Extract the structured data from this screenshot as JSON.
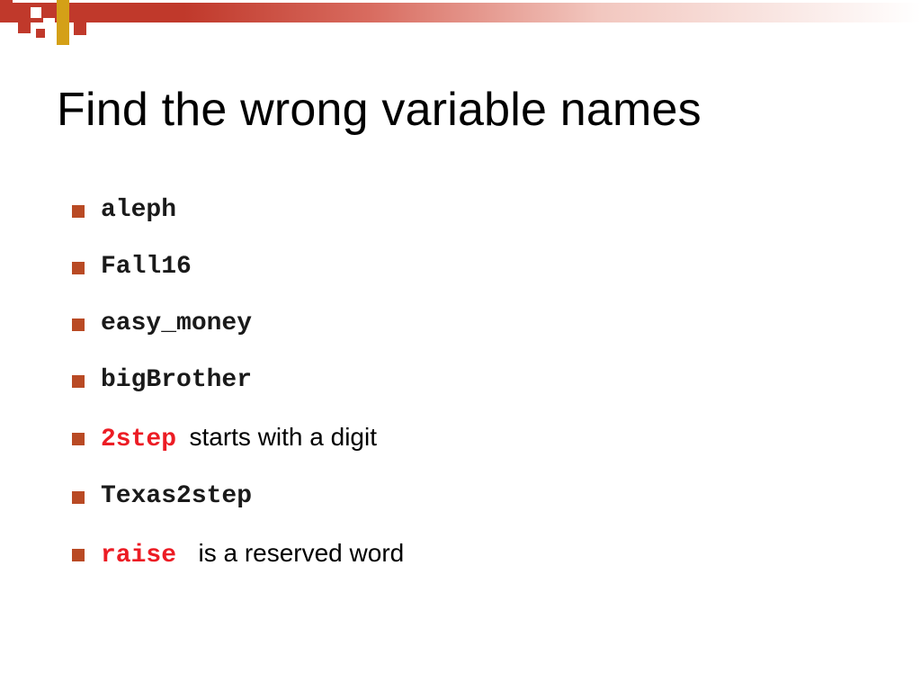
{
  "title": "Find the wrong variable names",
  "items": [
    {
      "code": "aleph",
      "code_color": "black",
      "note": ""
    },
    {
      "code": "Fall16",
      "code_color": "black",
      "note": ""
    },
    {
      "code": "easy_money",
      "code_color": "black",
      "note": ""
    },
    {
      "code": "bigBrother",
      "code_color": "black",
      "note": ""
    },
    {
      "code": "2step",
      "code_color": "red",
      "note": "starts with a digit"
    },
    {
      "code": "Texas2step",
      "code_color": "black",
      "note": ""
    },
    {
      "code": "raise",
      "code_color": "red",
      "note": "is a reserved word"
    }
  ]
}
